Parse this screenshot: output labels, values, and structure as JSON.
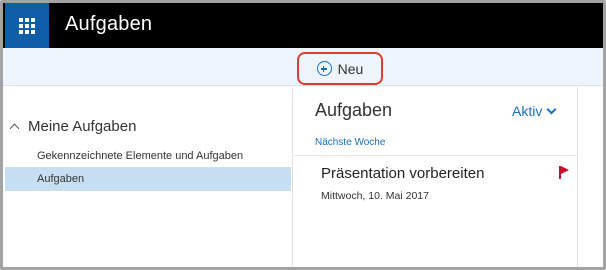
{
  "header": {
    "app_title": "Aufgaben",
    "app_launcher_icon": "waffle-grid-icon"
  },
  "command_bar": {
    "new_button_label": "Neu",
    "new_button_icon": "plus-circle-icon"
  },
  "left_nav": {
    "group_label": "Meine Aufgaben",
    "items": [
      {
        "label": "Gekennzeichnete Elemente und Aufgaben",
        "selected": false
      },
      {
        "label": "Aufgaben",
        "selected": true
      }
    ]
  },
  "task_pane": {
    "title": "Aufgaben",
    "filter_label": "Aktiv",
    "group_header": "Nächste Woche",
    "tasks": [
      {
        "title": "Präsentation vorbereiten",
        "due": "Mittwoch, 10. Mai 2017",
        "flagged": true
      }
    ]
  },
  "colors": {
    "accent": "#1a6fc1",
    "header_bg": "#000000",
    "launcher_bg": "#0f5ca8",
    "selection": "#c7dff2",
    "flag": "#c8102e",
    "highlight_ring": "#e13b2f"
  }
}
